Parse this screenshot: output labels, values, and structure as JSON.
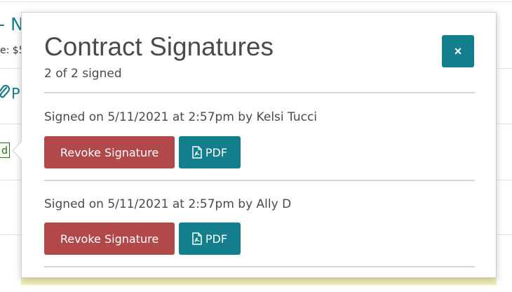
{
  "background": {
    "title_fragment": "- N",
    "meta_fragment": "e: $5",
    "attachment_fragment": "P",
    "tag_fragment": "d"
  },
  "popover": {
    "title": "Contract Signatures",
    "subtitle": "2 of 2 signed",
    "close_label": "×",
    "signatures": [
      {
        "text": "Signed on 5/11/2021 at 2:57pm by Kelsi Tucci",
        "revoke_label": "Revoke Signature",
        "pdf_label": "PDF"
      },
      {
        "text": "Signed on 5/11/2021 at 2:57pm by Ally D",
        "revoke_label": "Revoke Signature",
        "pdf_label": "PDF"
      }
    ]
  },
  "colors": {
    "teal": "#137f8c",
    "revoke_red": "#b2484a",
    "text": "#4a4a4a"
  },
  "icons": {
    "close": "close-icon",
    "pdf": "pdf-file-icon",
    "attachment": "paperclip-icon"
  }
}
